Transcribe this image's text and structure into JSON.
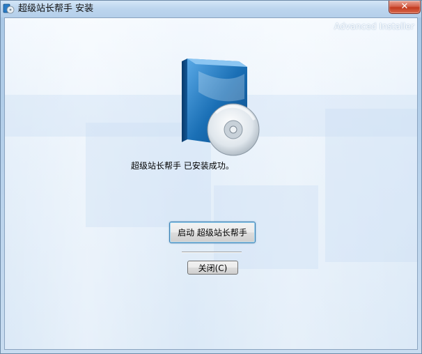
{
  "window": {
    "title": "超级站长帮手 安装",
    "close_glyph": "✕",
    "icon": "installer-app-icon"
  },
  "branding": {
    "text": "Advanced Installer"
  },
  "main": {
    "product_art_icon": "software-box-with-cd-icon",
    "status_text": "超级站长帮手 已安装成功。",
    "launch_button_label": "启动 超级站长帮手",
    "close_button_label": "关闭(C)"
  },
  "colors": {
    "box_blue": "#1a6fb5",
    "close_red": "#c23a1f",
    "focus_border": "#3c7fb1"
  }
}
